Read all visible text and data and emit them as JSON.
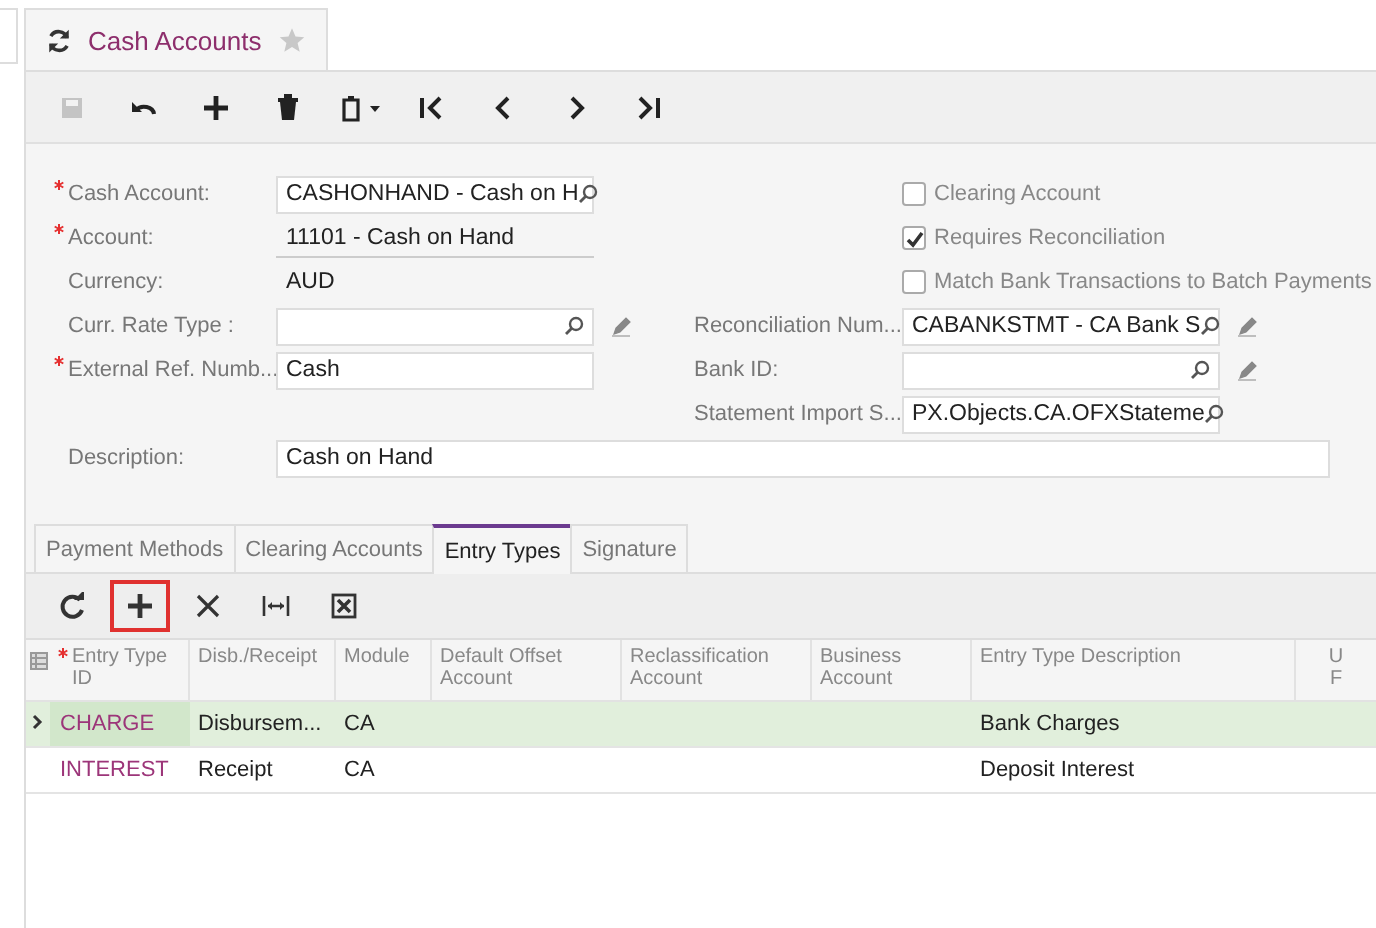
{
  "screen_tab": {
    "title": "Cash Accounts",
    "favorite": false
  },
  "toolbar": [
    {
      "kind": "save",
      "disabled": true
    },
    {
      "kind": "undo",
      "disabled": false
    },
    {
      "kind": "add",
      "disabled": false
    },
    {
      "kind": "delete",
      "disabled": false
    },
    {
      "kind": "paste",
      "disabled": false
    },
    {
      "kind": "first",
      "disabled": false
    },
    {
      "kind": "prev",
      "disabled": false
    },
    {
      "kind": "next",
      "disabled": false
    },
    {
      "kind": "last",
      "disabled": false
    }
  ],
  "form_left": [
    {
      "label": "Cash Account:",
      "required": true,
      "kind": "lookup",
      "value": "CASHONHAND - Cash on H",
      "edit_icon": false
    },
    {
      "label": "Account:",
      "required": true,
      "kind": "display",
      "value": "11101 - Cash on Hand",
      "edit_icon": false
    },
    {
      "label": "Currency:",
      "required": false,
      "kind": "plain",
      "value": "AUD",
      "edit_icon": false
    },
    {
      "label": "Curr. Rate Type :",
      "required": false,
      "kind": "lookup",
      "edit_icon": true
    },
    {
      "label": "External Ref. Numb...",
      "required": true,
      "kind": "text",
      "value": "Cash",
      "edit_icon": false
    }
  ],
  "form_right": [
    {
      "kind": "checkbox",
      "label": "Clearing Account",
      "checked": false
    },
    {
      "kind": "checkbox",
      "label": "Requires Reconciliation",
      "checked": true
    },
    {
      "kind": "checkbox",
      "label": "Match Bank Transactions to Batch Payments",
      "checked": false
    },
    {
      "kind": "lookup",
      "label": "Reconciliation Num...",
      "value": "CABANKSTMT - CA Bank S",
      "edit_icon": true
    },
    {
      "kind": "lookup",
      "label": "Bank ID:",
      "edit_icon": true
    },
    {
      "kind": "lookup",
      "label": "Statement Import S...",
      "value": "PX.Objects.CA.OFXStateme",
      "edit_icon": false
    }
  ],
  "description": {
    "label": "Description:",
    "value": "Cash on Hand"
  },
  "tabs": [
    {
      "label": "Payment Methods",
      "selected": false
    },
    {
      "label": "Clearing Accounts",
      "selected": false
    },
    {
      "label": "Entry Types",
      "selected": true
    },
    {
      "label": "Signature",
      "selected": false
    }
  ],
  "grid_toolbar": [
    {
      "kind": "refresh",
      "highlighted": false
    },
    {
      "kind": "add",
      "highlighted": true
    },
    {
      "kind": "delete",
      "highlighted": false
    },
    {
      "kind": "fit",
      "highlighted": false
    },
    {
      "kind": "export",
      "highlighted": false
    }
  ],
  "table": {
    "columns": [
      {
        "label": "Entry Type ID",
        "required": true
      },
      {
        "label": "Disb./Receipt",
        "required": false
      },
      {
        "label": "Module",
        "required": false
      },
      {
        "label": "Default Offset Account",
        "required": false
      },
      {
        "label": "Reclassification Account",
        "required": false
      },
      {
        "label": "Business Account",
        "required": false
      },
      {
        "label": "Entry Type Description",
        "required": false
      },
      {
        "label": "U F",
        "required": false
      }
    ],
    "rows": [
      {
        "selected": true,
        "cells": [
          "CHARGE",
          "Disbursem...",
          "CA",
          "",
          "",
          "",
          "Bank Charges",
          ""
        ]
      },
      {
        "selected": false,
        "cells": [
          "INTEREST",
          "Receipt",
          "CA",
          "",
          "",
          "",
          "Deposit Interest",
          ""
        ]
      }
    ]
  }
}
